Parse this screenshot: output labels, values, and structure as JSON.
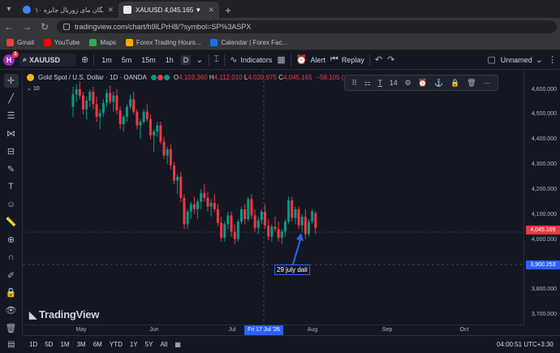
{
  "browser": {
    "tabs": [
      {
        "label": "۱۰ اکانت رایگان مای زوربال جایزه",
        "active": false
      },
      {
        "label": "XAUUSD 4,045.165 ▼ −1.42% U",
        "active": true
      }
    ],
    "url": "tradingview.com/chart/h9lLPrH8/?symbol=SP%3ASPX",
    "bookmarks": [
      {
        "label": "Gmail",
        "color": "#ea4335"
      },
      {
        "label": "YouTube",
        "color": "#ff0000"
      },
      {
        "label": "Maps",
        "color": "#34a853"
      },
      {
        "label": "Forex Trading Hours...",
        "color": "#f9ab00"
      },
      {
        "label": "Calendar | Forex Fac...",
        "color": "#1a73e8"
      }
    ]
  },
  "toolbar": {
    "avatar": "H",
    "badge": "1",
    "symbol": "XAUUSD",
    "timeframes": [
      "1m",
      "5m",
      "15m",
      "1h",
      "D"
    ],
    "active_timeframe": "D",
    "indicators": "Indicators",
    "alert": "Alert",
    "replay": "Replay",
    "layout_name": "Unnamed"
  },
  "legend": {
    "name": "Gold Spot / U.S. Dollar · 1D · OANDA",
    "o_label": "O",
    "o": "4,103.360",
    "h_label": "H",
    "h": "4,112.010",
    "l_label": "L",
    "l": "4,020.975",
    "c_label": "C",
    "c": "4,045.165",
    "change": "−58.105 (−1.42%)",
    "indicator_count": "10"
  },
  "drawing_toolbar": {
    "font_size": "14"
  },
  "annotation": "29 july dali",
  "watermark": "TradingView",
  "price_axis": {
    "labels": [
      "4,600.000",
      "4,500.000",
      "4,400.000",
      "4,300.000",
      "4,200.000",
      "4,100.000",
      "4,000.000",
      "3,800.000",
      "3,700.000"
    ],
    "current_price": "4,045.165",
    "cursor_price": "3,900.253",
    "current_color": "#f23645",
    "cursor_color": "#2962ff"
  },
  "time_axis": {
    "labels": [
      "May",
      "Jun",
      "Jul",
      "Aug",
      "Sep",
      "Oct"
    ],
    "cursor_date": "Fri 17 Jul '26"
  },
  "bottom_bar": {
    "ranges": [
      "1D",
      "5D",
      "1M",
      "3M",
      "6M",
      "YTD",
      "1Y",
      "5Y",
      "All"
    ],
    "clock": "04:00:51 UTC+3:30"
  },
  "chart_data": {
    "type": "candlestick",
    "y_axis_range": [
      3650,
      4650
    ],
    "candles": [
      [
        4530,
        4610,
        4490,
        4580
      ],
      [
        4580,
        4620,
        4550,
        4600
      ],
      [
        4600,
        4630,
        4560,
        4575
      ],
      [
        4575,
        4590,
        4500,
        4520
      ],
      [
        4520,
        4570,
        4480,
        4555
      ],
      [
        4555,
        4600,
        4530,
        4590
      ],
      [
        4590,
        4610,
        4520,
        4540
      ],
      [
        4540,
        4570,
        4470,
        4490
      ],
      [
        4490,
        4520,
        4440,
        4505
      ],
      [
        4505,
        4560,
        4490,
        4545
      ],
      [
        4545,
        4600,
        4530,
        4585
      ],
      [
        4585,
        4615,
        4540,
        4550
      ],
      [
        4550,
        4590,
        4510,
        4575
      ],
      [
        4575,
        4600,
        4500,
        4515
      ],
      [
        4515,
        4530,
        4440,
        4460
      ],
      [
        4460,
        4500,
        4430,
        4490
      ],
      [
        4490,
        4540,
        4470,
        4530
      ],
      [
        4530,
        4580,
        4520,
        4560
      ],
      [
        4560,
        4590,
        4500,
        4510
      ],
      [
        4510,
        4520,
        4440,
        4455
      ],
      [
        4455,
        4480,
        4400,
        4470
      ],
      [
        4470,
        4520,
        4460,
        4510
      ],
      [
        4510,
        4540,
        4470,
        4480
      ],
      [
        4480,
        4500,
        4400,
        4415
      ],
      [
        4415,
        4440,
        4350,
        4430
      ],
      [
        4430,
        4470,
        4410,
        4455
      ],
      [
        4455,
        4470,
        4380,
        4390
      ],
      [
        4390,
        4410,
        4320,
        4335
      ],
      [
        4335,
        4370,
        4300,
        4360
      ],
      [
        4360,
        4380,
        4280,
        4295
      ],
      [
        4295,
        4310,
        4220,
        4235
      ],
      [
        4235,
        4260,
        4180,
        4250
      ],
      [
        4250,
        4270,
        4150,
        4165
      ],
      [
        4165,
        4180,
        4040,
        4060
      ],
      [
        4060,
        4120,
        4040,
        4110
      ],
      [
        4110,
        4150,
        4080,
        4140
      ],
      [
        4140,
        4170,
        4100,
        4120
      ],
      [
        4120,
        4160,
        4080,
        4150
      ],
      [
        4150,
        4200,
        4120,
        4185
      ],
      [
        4185,
        4220,
        4150,
        4165
      ],
      [
        4165,
        4190,
        4110,
        4130
      ],
      [
        4130,
        4160,
        4090,
        4145
      ],
      [
        4145,
        4180,
        4110,
        4120
      ],
      [
        4120,
        4140,
        4050,
        4065
      ],
      [
        4065,
        4090,
        3990,
        4005
      ],
      [
        4005,
        4070,
        3990,
        4060
      ],
      [
        4060,
        4110,
        4040,
        4095
      ],
      [
        4095,
        4110,
        4010,
        4030
      ],
      [
        4030,
        4060,
        3980,
        4000
      ],
      [
        4000,
        4080,
        3990,
        4070
      ],
      [
        4070,
        4130,
        4060,
        4120
      ],
      [
        4120,
        4140,
        4060,
        4080
      ],
      [
        4080,
        4170,
        4070,
        4160
      ],
      [
        4160,
        4180,
        4080,
        4095
      ],
      [
        4095,
        4120,
        4030,
        4045
      ],
      [
        4045,
        4090,
        4020,
        4075
      ],
      [
        4075,
        4120,
        4060,
        4110
      ],
      [
        4110,
        4140,
        4040,
        4055
      ],
      [
        4055,
        4080,
        3995,
        4010
      ],
      [
        4010,
        4060,
        3990,
        4050
      ],
      [
        4050,
        4090,
        4030,
        4040
      ],
      [
        4040,
        4070,
        3990,
        4005
      ],
      [
        4005,
        4040,
        3980,
        4030
      ],
      [
        4030,
        4080,
        4010,
        4070
      ],
      [
        4070,
        4170,
        4060,
        4155
      ],
      [
        4155,
        4170,
        4070,
        4085
      ],
      [
        4085,
        4130,
        4060,
        4120
      ],
      [
        4120,
        4130,
        4040,
        4055
      ],
      [
        4055,
        4100,
        4030,
        4090
      ],
      [
        4090,
        4120,
        4000,
        4020
      ],
      [
        4020,
        4080,
        4010,
        4070
      ],
      [
        4070,
        4120,
        4060,
        4110
      ],
      [
        4103.36,
        4112.01,
        4020.975,
        4045.165
      ]
    ]
  }
}
